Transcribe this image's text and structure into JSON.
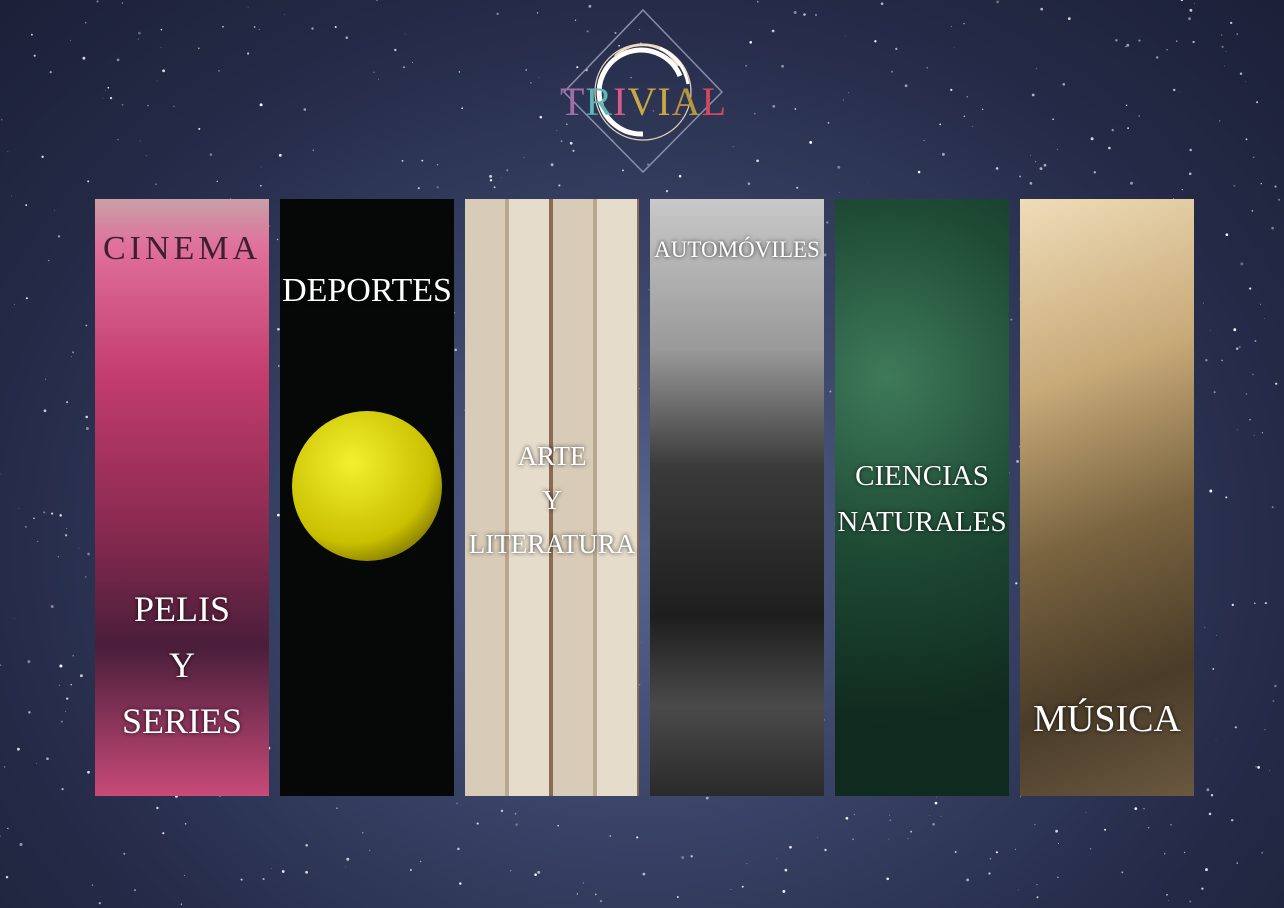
{
  "logo": {
    "letters": [
      "T",
      "R",
      "I",
      "V",
      "I",
      "A",
      "L"
    ],
    "colors": [
      "#a46ca6",
      "#5fb6b4",
      "#d75b8c",
      "#c8a845",
      "#c8a845",
      "#b89640",
      "#d4485f"
    ]
  },
  "categories": [
    {
      "label": "PELIS Y SERIES",
      "lines": [
        "PELIS",
        "Y",
        "SERIES"
      ],
      "sign": "CINEMA",
      "image": "cinema-photo"
    },
    {
      "label": "DEPORTES",
      "lines": [
        "DEPORTES"
      ],
      "image": "tennis-ball-photo"
    },
    {
      "label": "ARTE Y LITERATURA",
      "lines": [
        "ARTE",
        "Y",
        "LITERATURA"
      ],
      "image": "books-photo"
    },
    {
      "label": "AUTOMÓVILES",
      "lines": [
        "AUTOMÓVILES"
      ],
      "image": "car-photo"
    },
    {
      "label": "CIENCIAS NATURALES",
      "lines": [
        "CIENCIAS",
        "NATURALES"
      ],
      "image": "leaves-photo"
    },
    {
      "label": "MÚSICA",
      "lines": [
        "MÚSICA"
      ],
      "image": "record-player-photo"
    }
  ]
}
